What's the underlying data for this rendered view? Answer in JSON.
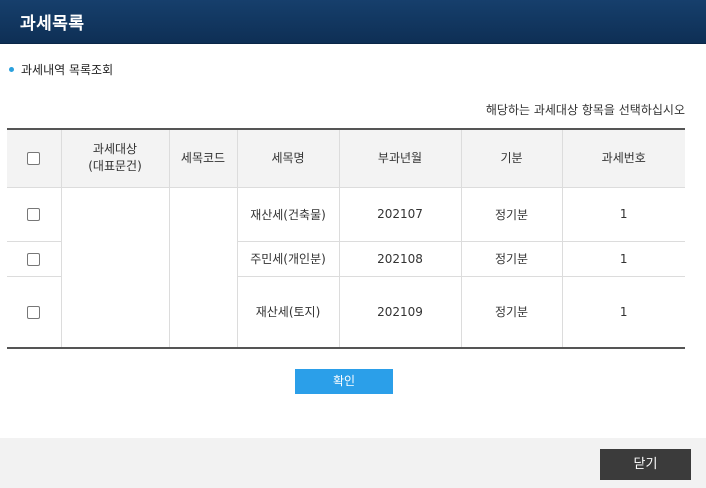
{
  "header": {
    "title": "과세목록"
  },
  "section": {
    "title": "과세내역 목록조회"
  },
  "instruction": "해당하는 과세대상 항목을 선택하십시오",
  "table": {
    "headers": {
      "target_line1": "과세대상",
      "target_line2": "(대표문건)",
      "code": "세목코드",
      "name": "세목명",
      "month": "부과년월",
      "period": "기분",
      "number": "과세번호"
    },
    "rows": [
      {
        "name": "재산세(건축물)",
        "month": "202107",
        "period": "정기분",
        "number": "1"
      },
      {
        "name": "주민세(개인분)",
        "month": "202108",
        "period": "정기분",
        "number": "1"
      },
      {
        "name": "재산세(토지)",
        "month": "202109",
        "period": "정기분",
        "number": "1"
      }
    ]
  },
  "buttons": {
    "confirm": "확인",
    "close": "닫기"
  },
  "colors": {
    "header": "#163f6c",
    "confirm": "#2b9fe9",
    "close": "#3b3b3b",
    "bullet": "#2aa0dd"
  }
}
